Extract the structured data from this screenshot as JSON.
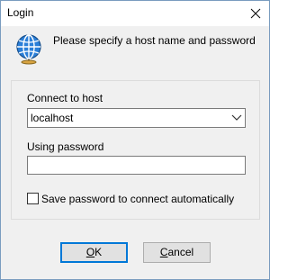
{
  "window": {
    "title": "Login",
    "close_icon": "close-icon"
  },
  "header": {
    "icon": "globe-icon",
    "message": "Please specify a host name and password"
  },
  "form": {
    "host_label": "Connect to host",
    "host_value": "localhost",
    "password_label": "Using password",
    "password_value": "",
    "save_checkbox_label": "Save password to connect automatically",
    "save_checked": false
  },
  "buttons": {
    "ok_mnemonic": "O",
    "ok_rest": "K",
    "cancel_mnemonic": "C",
    "cancel_rest": "ancel"
  },
  "colors": {
    "accent": "#0078d7",
    "globe_blue": "#1f6fc5",
    "background": "#f0f0f0"
  }
}
